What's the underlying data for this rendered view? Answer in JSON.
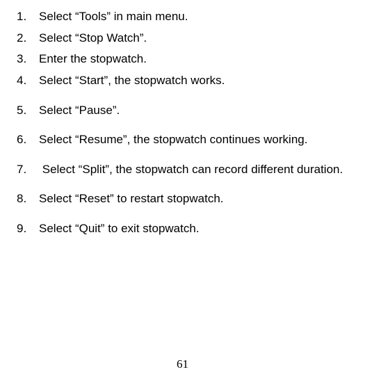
{
  "steps": [
    {
      "n": "1.",
      "text": "Select “Tools” in main menu."
    },
    {
      "n": "2.",
      "text": "Select “Stop Watch”."
    },
    {
      "n": "3.",
      "text": "Enter the stopwatch."
    },
    {
      "n": "4.",
      "text": "Select “Start”, the stopwatch works."
    },
    {
      "n": "5.",
      "text": "Select “Pause”."
    },
    {
      "n": "6.",
      "text": "Select “Resume”, the stopwatch continues working."
    },
    {
      "n": "7.",
      "text": "Select “Split”, the stopwatch can record different duration."
    },
    {
      "n": "8.",
      "text": "Select “Reset” to restart stopwatch."
    },
    {
      "n": "9.",
      "text": "Select “Quit” to exit stopwatch."
    }
  ],
  "page_number": "61"
}
